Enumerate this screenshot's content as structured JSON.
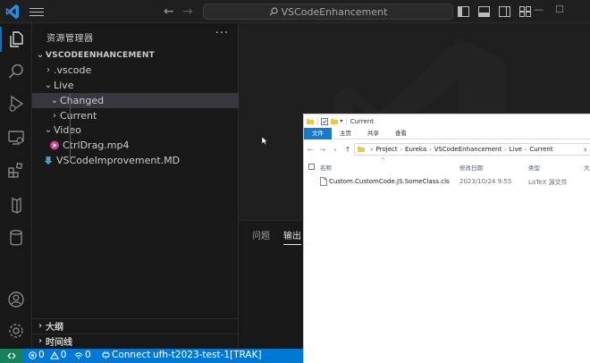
{
  "titlebar": {
    "search_text": "VSCodeEnhancement",
    "back_arrow": "←",
    "forward_arrow": "→",
    "minimize": "—",
    "maximize": "☐"
  },
  "sidebar": {
    "title": "资源管理器",
    "more": "···",
    "root": "VSCODEENHANCEMENT",
    "tree": [
      {
        "label": ".vscode",
        "chevron": "›"
      },
      {
        "label": "Live",
        "chevron": "⌄"
      },
      {
        "label": "Changed",
        "chevron": "⌄"
      },
      {
        "label": "Current",
        "chevron": "›"
      },
      {
        "label": "Video",
        "chevron": "⌄"
      },
      {
        "label": "CtrlDrag.mp4"
      },
      {
        "label": "VSCodeImprovement.MD"
      }
    ],
    "outline": "大纲",
    "timeline": "时间线"
  },
  "panel": {
    "tab_problems": "问题",
    "tab_output": "输出"
  },
  "statusbar": {
    "errors": "0",
    "warnings": "0",
    "ports": "0",
    "connect": "Connect",
    "branch": "ufh-t2023-test-1[TRAK]"
  },
  "explorer": {
    "title": "Current",
    "ribbon_tabs": [
      "文件",
      "主页",
      "共享",
      "查看"
    ],
    "breadcrumb": [
      "Project",
      "Eureka",
      "VSCodeEnhancement",
      "Live",
      "Current"
    ],
    "columns": {
      "name": "名称",
      "date": "修改日期",
      "type": "类型",
      "size": "大"
    },
    "files": [
      {
        "name": "Custom.CustomCode.JS.SomeClass.cls",
        "date": "2023/10/24 9:55",
        "type": "LaTeX 源文件"
      }
    ]
  },
  "colors": {
    "accent": "#0078d4",
    "remote": "#16825d",
    "explorer_file_tab": "#1979ca"
  }
}
